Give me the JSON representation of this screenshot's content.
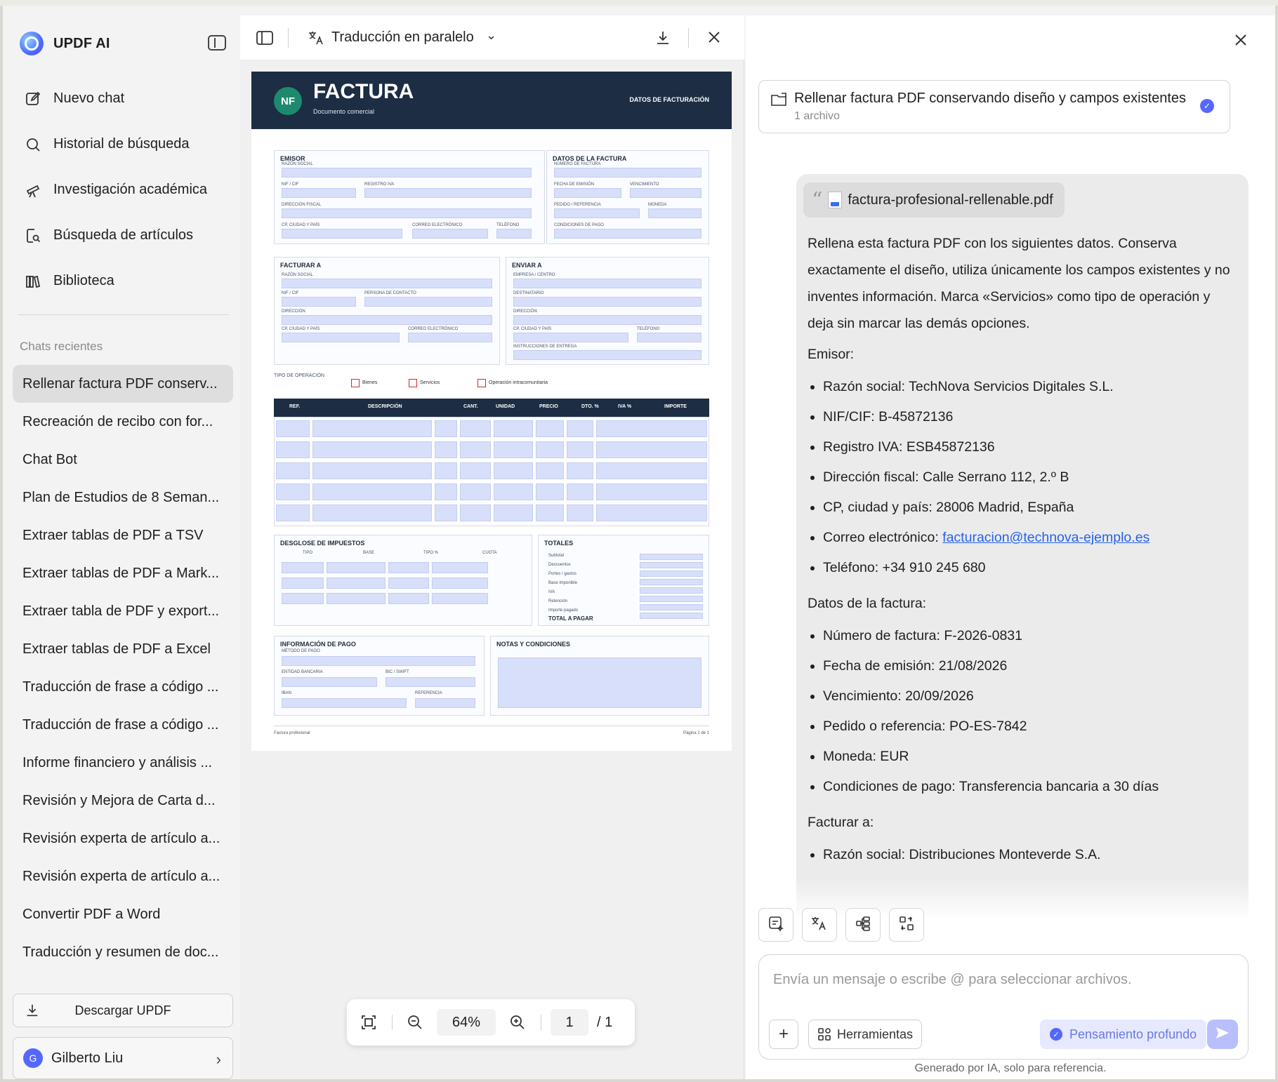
{
  "sidebar": {
    "brand": "UPDF AI",
    "nav": [
      {
        "label": "Nuevo chat",
        "icon": "new-chat-icon"
      },
      {
        "label": "Historial de búsqueda",
        "icon": "search-icon"
      },
      {
        "label": "Investigación académica",
        "icon": "telescope-icon"
      },
      {
        "label": "Búsqueda de artículos",
        "icon": "document-search-icon"
      },
      {
        "label": "Biblioteca",
        "icon": "library-icon"
      }
    ],
    "recent_title": "Chats recientes",
    "recent": [
      "Rellenar factura PDF conserv...",
      "Recreación de recibo con for...",
      "Chat Bot",
      "Plan de Estudios de 8 Seman...",
      "Extraer tablas de PDF a TSV",
      "Extraer tablas de PDF a Mark...",
      "Extraer tabla de PDF y export...",
      "Extraer tablas de PDF a Excel",
      "Traducción de frase a código ...",
      "Traducción de frase a código ...",
      "Informe financiero y análisis ...",
      "Revisión y Mejora de Carta d...",
      "Revisión experta de artículo a...",
      "Revisión experta de artículo a...",
      "Convertir PDF a Word",
      "Traducción y resumen de doc..."
    ],
    "download_label": "Descargar UPDF",
    "user": {
      "initial": "G",
      "name": "Gilberto Liu"
    }
  },
  "viewer": {
    "mode_label": "Traducción en paralelo",
    "zoom": "64%",
    "page_current": "1",
    "page_total": "/ 1",
    "pdf": {
      "badge": "NF",
      "title": "FACTURA",
      "subtitle": "Documento comercial",
      "header_right": "DATOS DE FACTURACIÓN",
      "emisor": "EMISOR",
      "razon_social": "RAZÓN SOCIAL",
      "nif": "NIF / CIF",
      "registro_iva": "REGISTRO IVA",
      "direccion_fiscal": "DIRECCIÓN FISCAL",
      "cp": "CP, CIUDAD Y PAÍS",
      "correo": "CORREO ELECTRÓNICO",
      "telefono": "TELÉFONO",
      "datos_factura": "DATOS DE LA FACTURA",
      "numero_factura": "NÚMERO DE FACTURA",
      "fecha_emision": "FECHA DE EMISIÓN",
      "vencimiento": "VENCIMIENTO",
      "pedido": "PEDIDO / REFERENCIA",
      "moneda": "MONEDA",
      "condiciones": "CONDICIONES DE PAGO",
      "facturar_a": "FACTURAR A",
      "persona_contacto": "PERSONA DE CONTACTO",
      "direccion": "DIRECCIÓN",
      "enviar_a": "ENVIAR A",
      "empresa_centro": "EMPRESA / CENTRO",
      "destinatario": "DESTINATARIO",
      "instrucciones": "INSTRUCCIONES DE ENTREGA",
      "tipo_operacion": "TIPO DE OPERACIÓN",
      "op_bienes": "Bienes",
      "op_servicios": "Servicios",
      "op_intra": "Operación intracomunitaria",
      "cols": [
        "REF.",
        "DESCRIPCIÓN",
        "CANT.",
        "UNIDAD",
        "PRECIO",
        "DTO. %",
        "IVA %",
        "IMPORTE"
      ],
      "desglose": "DESGLOSE DE IMPUESTOS",
      "desglose_cols": [
        "TIPO",
        "BASE",
        "TIPO %",
        "CUOTA"
      ],
      "totales": "TOTALES",
      "totales_rows": [
        "Subtotal",
        "Descuentos",
        "Portes / gastos",
        "Base imponible",
        "IVA",
        "Retención",
        "Importe pagado"
      ],
      "total_pagar": "TOTAL A PAGAR",
      "info_pago": "INFORMACIÓN DE PAGO",
      "metodo_pago": "MÉTODO DE PAGO",
      "entidad": "ENTIDAD BANCARIA",
      "bic": "BIC / SWIFT",
      "iban": "IBAN",
      "referencia": "REFERENCIA",
      "notas": "NOTAS Y CONDICIONES",
      "footer_left": "Factura profesional",
      "footer_right": "Página 1 de 1"
    }
  },
  "chat": {
    "task": {
      "title": "Rellenar factura PDF conservando diseño y campos existentes",
      "sub": "1 archivo"
    },
    "file_name": "factura-profesional-rellenable.pdf",
    "intro": "Rellena esta factura PDF con los siguientes datos. Conserva exactamente el diseño, utiliza únicamente los campos existentes y no inventes información. Marca «Servicios» como tipo de operación y deja sin marcar las demás opciones.",
    "emisor_title": "Emisor:",
    "emisor": [
      "Razón social: TechNova Servicios Digitales S.L.",
      "NIF/CIF: B-45872136",
      "Registro IVA: ESB45872136",
      "Dirección fiscal: Calle Serrano 112, 2.º B",
      "CP, ciudad y país: 28006 Madrid, España"
    ],
    "email_label": "Correo electrónico: ",
    "email": "facturacion@technova-ejemplo.es",
    "telefono": "Teléfono: +34 910 245 680",
    "factura_title": "Datos de la factura:",
    "factura": [
      "Número de factura: F-2026-0831",
      "Fecha de emisión: 21/08/2026",
      "Vencimiento: 20/09/2026",
      "Pedido o referencia: PO-ES-7842",
      "Moneda: EUR",
      "Condiciones de pago: Transferencia bancaria a 30 días"
    ],
    "facturar_title": "Facturar a:",
    "facturar": [
      "Razón social: Distribuciones Monteverde S.A."
    ],
    "placeholder": "Envía un mensaje o escribe @ para seleccionar archivos.",
    "tools_label": "Herramientas",
    "think_label": "Pensamiento profundo",
    "disclaimer": "Generado por IA, solo para referencia."
  }
}
